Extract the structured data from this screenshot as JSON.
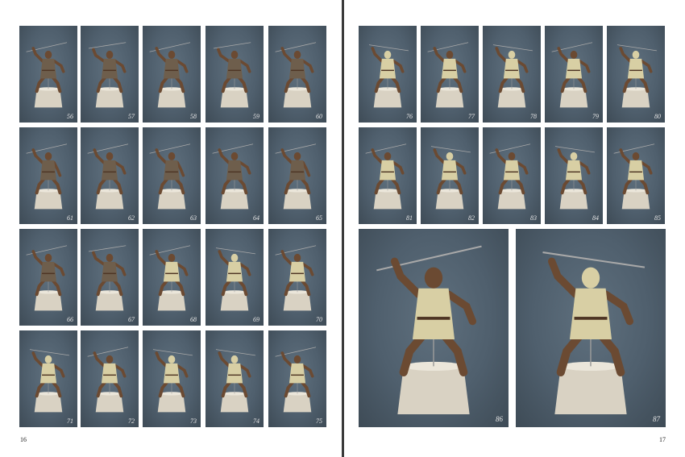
{
  "pages": {
    "left_number": "16",
    "right_number": "17"
  },
  "colors": {
    "background": "#4f5f6d",
    "skin": "#6b4a32",
    "skin_dark": "#4e3524",
    "tunic_brown": "#6e5e4c",
    "tunic_cream": "#d8cfa4",
    "base": "#d9d2c3",
    "spear": "#a8a8a8"
  },
  "photos": [
    {
      "label": "56",
      "tunic": "brown",
      "pose": "a"
    },
    {
      "label": "57",
      "tunic": "brown",
      "pose": "b"
    },
    {
      "label": "58",
      "tunic": "brown",
      "pose": "a"
    },
    {
      "label": "59",
      "tunic": "brown",
      "pose": "b"
    },
    {
      "label": "60",
      "tunic": "brown",
      "pose": "a"
    },
    {
      "label": "61",
      "tunic": "brown",
      "pose": "side"
    },
    {
      "label": "62",
      "tunic": "brown",
      "pose": "a"
    },
    {
      "label": "63",
      "tunic": "brown",
      "pose": "side"
    },
    {
      "label": "64",
      "tunic": "brown",
      "pose": "a"
    },
    {
      "label": "65",
      "tunic": "brown",
      "pose": "side"
    },
    {
      "label": "66",
      "tunic": "brown",
      "pose": "a"
    },
    {
      "label": "67",
      "tunic": "brown",
      "pose": "b"
    },
    {
      "label": "68",
      "tunic": "cream",
      "pose": "a"
    },
    {
      "label": "69",
      "tunic": "cream",
      "pose": "back"
    },
    {
      "label": "70",
      "tunic": "cream",
      "pose": "a"
    },
    {
      "label": "71",
      "tunic": "cream",
      "pose": "back"
    },
    {
      "label": "72",
      "tunic": "cream",
      "pose": "a"
    },
    {
      "label": "73",
      "tunic": "cream",
      "pose": "back"
    },
    {
      "label": "74",
      "tunic": "cream",
      "pose": "back"
    },
    {
      "label": "75",
      "tunic": "cream",
      "pose": "a"
    },
    {
      "label": "76",
      "tunic": "cream",
      "pose": "back"
    },
    {
      "label": "77",
      "tunic": "cream",
      "pose": "a"
    },
    {
      "label": "78",
      "tunic": "cream",
      "pose": "back"
    },
    {
      "label": "79",
      "tunic": "cream",
      "pose": "a"
    },
    {
      "label": "80",
      "tunic": "cream",
      "pose": "back"
    },
    {
      "label": "81",
      "tunic": "cream",
      "pose": "a"
    },
    {
      "label": "82",
      "tunic": "cream",
      "pose": "back"
    },
    {
      "label": "83",
      "tunic": "cream",
      "pose": "a"
    },
    {
      "label": "84",
      "tunic": "cream",
      "pose": "back"
    },
    {
      "label": "85",
      "tunic": "cream",
      "pose": "a"
    },
    {
      "label": "86",
      "tunic": "cream",
      "pose": "a"
    },
    {
      "label": "87",
      "tunic": "cream",
      "pose": "back"
    }
  ]
}
